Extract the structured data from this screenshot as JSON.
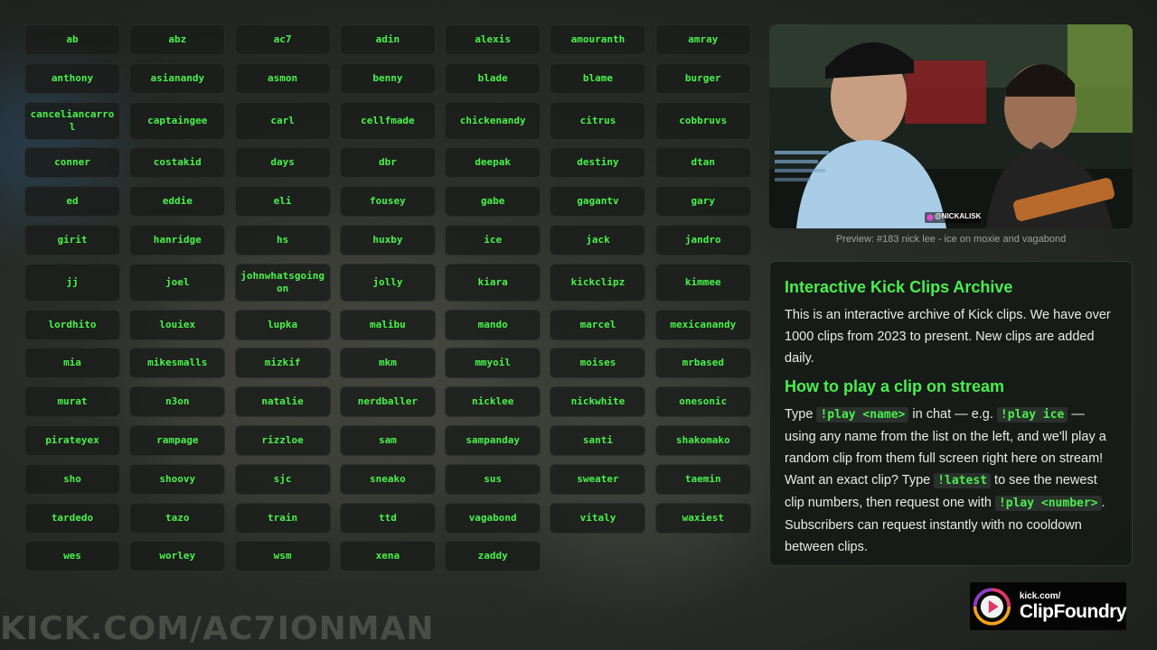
{
  "names": [
    [
      "ab",
      "abz",
      "ac7",
      "adin",
      "alexis",
      "amouranth",
      "amray"
    ],
    [
      "anthony",
      "asianandy",
      "asmon",
      "benny",
      "blade",
      "blame",
      "burger"
    ],
    [
      "canceliancarrol",
      "captaingee",
      "carl",
      "cellfmade",
      "chickenandy",
      "citrus",
      "cobbruvs"
    ],
    [
      "conner",
      "costakid",
      "days",
      "dbr",
      "deepak",
      "destiny",
      "dtan"
    ],
    [
      "ed",
      "eddie",
      "eli",
      "fousey",
      "gabe",
      "gagantv",
      "gary"
    ],
    [
      "girit",
      "hanridge",
      "hs",
      "huxby",
      "ice",
      "jack",
      "jandro"
    ],
    [
      "jj",
      "joel",
      "johnwhatsgoingon",
      "jolly",
      "kiara",
      "kickclipz",
      "kimmee"
    ],
    [
      "lordhito",
      "louiex",
      "lupka",
      "malibu",
      "mando",
      "marcel",
      "mexicanandy"
    ],
    [
      "mia",
      "mikesmalls",
      "mizkif",
      "mkm",
      "mmyoil",
      "moises",
      "mrbased"
    ],
    [
      "murat",
      "n3on",
      "natalie",
      "nerdballer",
      "nicklee",
      "nickwhite",
      "onesonic"
    ],
    [
      "pirateyex",
      "rampage",
      "rizzloe",
      "sam",
      "sampanday",
      "santi",
      "shakomako"
    ],
    [
      "sho",
      "shoovy",
      "sjc",
      "sneako",
      "sus",
      "sweater",
      "taemin"
    ],
    [
      "tardedo",
      "tazo",
      "train",
      "ttd",
      "vagabond",
      "vitaly",
      "waxiest"
    ],
    [
      "wes",
      "worley",
      "wsm",
      "xena",
      "zaddy"
    ]
  ],
  "preview": {
    "caption": "Preview: #183 nick lee - ice on moxie and vagabond",
    "overlay_tag": "@NICKALISK"
  },
  "info": {
    "title1": "Interactive Kick Clips Archive",
    "intro": "This is an interactive archive of Kick clips. We have over 1000 clips from 2023 to present. New clips are added daily.",
    "title2": "How to play a clip on stream",
    "how_1": "Type ",
    "code_play_name": "!play <name>",
    "how_2": " in chat — e.g. ",
    "code_play_ice": "!play ice",
    "how_3": " — using any name from the list on the left, and we'll play a random clip from them full screen right here on stream! Want an exact clip? Type ",
    "code_latest": "!latest",
    "how_4": " to see the newest clip numbers, then request one with ",
    "code_play_number": "!play <number>",
    "how_5": ". Subscribers can request instantly with no cooldown between clips."
  },
  "logo": {
    "small": "kick.com/",
    "big": "ClipFoundry"
  },
  "watermark": "KICK.COM/AC7IONMAN",
  "colors": {
    "accent": "#4bee4d",
    "button_text": "#49f24b",
    "panel_bg": "#161a17"
  }
}
